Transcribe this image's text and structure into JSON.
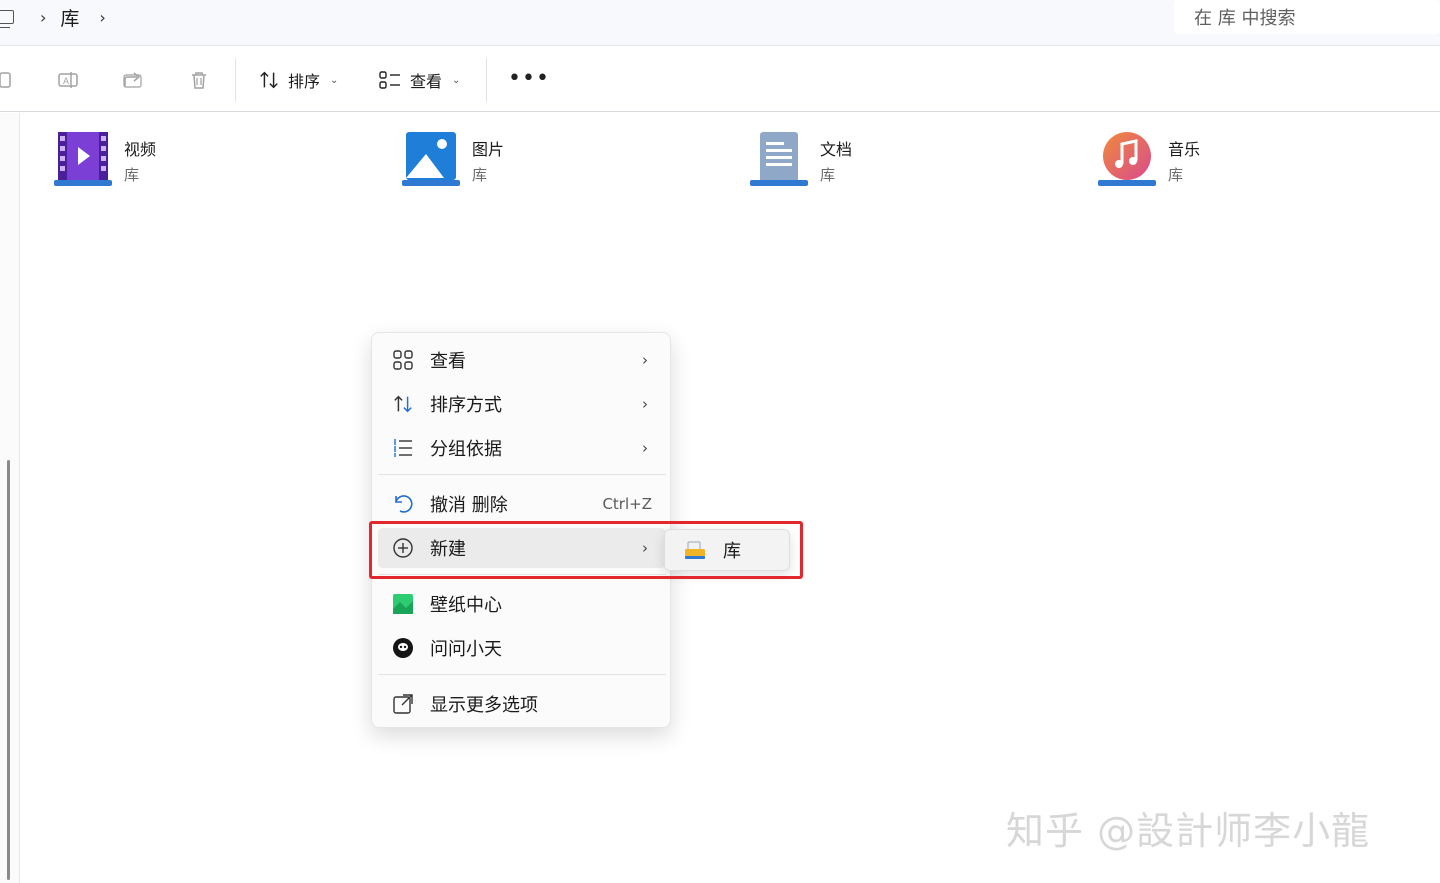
{
  "breadcrumb": {
    "current": "库",
    "separator": ">"
  },
  "search": {
    "placeholder": "在 库 中搜索"
  },
  "toolbar": {
    "sort_label": "排序",
    "view_label": "查看",
    "more_label": "•••"
  },
  "libraries": [
    {
      "name": "视频",
      "type": "库",
      "icon": "video-library-icon",
      "color": "#7b3fd6"
    },
    {
      "name": "图片",
      "type": "库",
      "icon": "pictures-library-icon",
      "color": "#1f7fd8"
    },
    {
      "name": "文档",
      "type": "库",
      "icon": "documents-library-icon",
      "color": "#5c7fa8"
    },
    {
      "name": "音乐",
      "type": "库",
      "icon": "music-library-icon",
      "color": "#e8634a"
    }
  ],
  "context_menu": {
    "items": [
      {
        "label": "查看",
        "icon": "grid-view-icon",
        "submenu": true
      },
      {
        "label": "排序方式",
        "icon": "sort-icon",
        "submenu": true
      },
      {
        "label": "分组依据",
        "icon": "group-list-icon",
        "submenu": true
      },
      {
        "label": "撤消 删除",
        "icon": "undo-icon",
        "shortcut": "Ctrl+Z"
      },
      {
        "label": "新建",
        "icon": "plus-circle-icon",
        "submenu": true
      },
      {
        "label": "壁纸中心",
        "icon": "wallpaper-icon"
      },
      {
        "label": "问问小天",
        "icon": "assistant-icon"
      },
      {
        "label": "显示更多选项",
        "icon": "open-external-icon"
      }
    ],
    "new_submenu": {
      "label": "库",
      "icon": "new-library-icon"
    }
  },
  "watermark": "知乎 @設計师李小龍",
  "colors": {
    "highlight_box": "#e0282e",
    "menu_bg": "#fbfbfb"
  }
}
